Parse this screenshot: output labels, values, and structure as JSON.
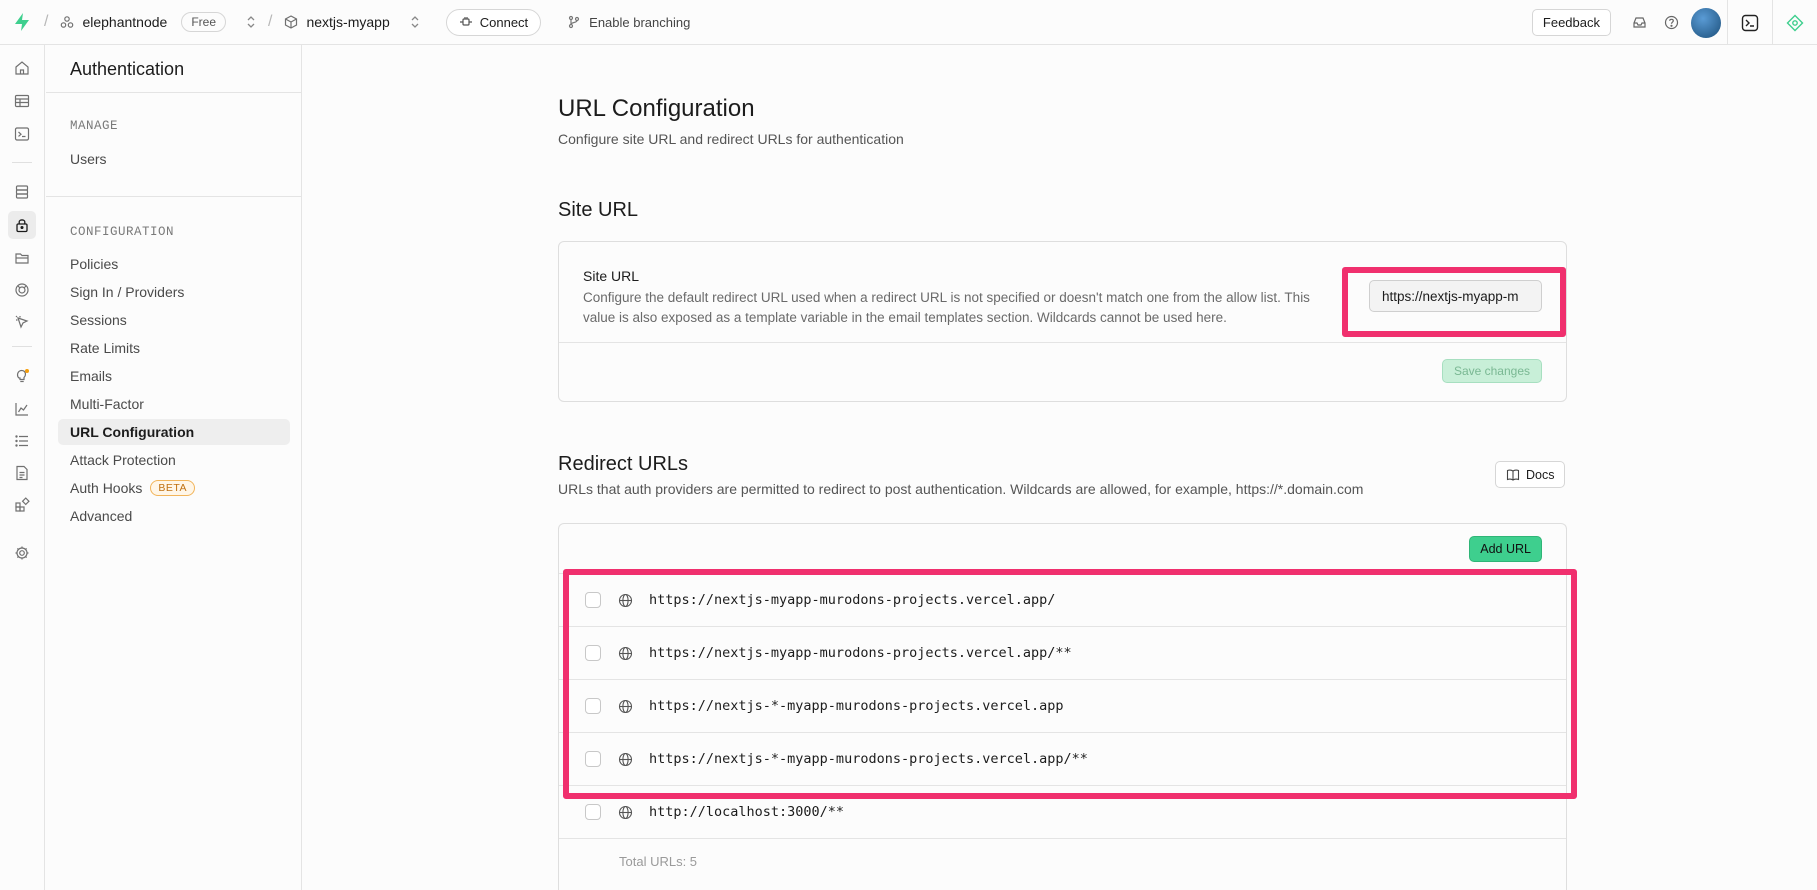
{
  "topbar": {
    "org_name": "elephantnode",
    "plan_badge": "Free",
    "project_name": "nextjs-myapp",
    "connect_label": "Connect",
    "branching_label": "Enable branching",
    "feedback_label": "Feedback"
  },
  "sidebar": {
    "title": "Authentication",
    "manage_heading": "MANAGE",
    "manage_items": [
      "Users"
    ],
    "config_heading": "CONFIGURATION",
    "config_items": [
      "Policies",
      "Sign In / Providers",
      "Sessions",
      "Rate Limits",
      "Emails",
      "Multi-Factor",
      "URL Configuration",
      "Attack Protection",
      "Auth Hooks",
      "Advanced"
    ],
    "active_item": "URL Configuration",
    "beta_badge": "BETA"
  },
  "page": {
    "title": "URL Configuration",
    "subtitle": "Configure site URL and redirect URLs for authentication"
  },
  "site_url": {
    "heading": "Site URL",
    "label": "Site URL",
    "description": "Configure the default redirect URL used when a redirect URL is not specified or doesn't match one from the allow list. This value is also exposed as a template variable in the email templates section. Wildcards cannot be used here.",
    "value": "https://nextjs-myapp-m",
    "save_label": "Save changes"
  },
  "redirect_urls": {
    "heading": "Redirect URLs",
    "description": "URLs that auth providers are permitted to redirect to post authentication. Wildcards are allowed, for example, https://*.domain.com",
    "docs_label": "Docs",
    "add_label": "Add URL",
    "urls": [
      "https://nextjs-myapp-murodons-projects.vercel.app/",
      "https://nextjs-myapp-murodons-projects.vercel.app/**",
      "https://nextjs-*-myapp-murodons-projects.vercel.app",
      "https://nextjs-*-myapp-murodons-projects.vercel.app/**",
      "http://localhost:3000/**"
    ],
    "total_label": "Total URLs: 5"
  },
  "colors": {
    "accent": "#3ecf8e",
    "highlight": "#f0306e"
  }
}
